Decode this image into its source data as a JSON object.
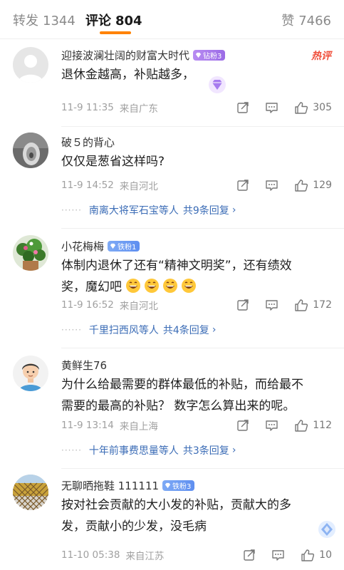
{
  "tabs": {
    "repost_label": "转发",
    "repost_count": "1344",
    "comment_label": "评论",
    "comment_count": "804",
    "like_label": "赞",
    "like_count": "7466"
  },
  "colors": {
    "accent": "#ff8200",
    "link": "#3b6cb6",
    "hot": "#f0503c"
  },
  "comments": [
    {
      "username": "迎接波澜壮阔的财富大时代",
      "badge": "钻粉3",
      "hot_tag": "热评",
      "text": "退休金越高，补贴越多，",
      "time": "11-9 11:35",
      "location": "来自广东",
      "likes": "305"
    },
    {
      "username": "破５的背心",
      "text": "仅仅是葱省这样吗?",
      "time": "11-9 14:52",
      "location": "来自河北",
      "likes": "129",
      "reply_users": "南离大将军石宝等人",
      "reply_count": "共9条回复"
    },
    {
      "username": "小花梅梅",
      "badge": "铁粉1",
      "text_line1": "体制内退休了还有“精神文明奖”，还有绩效",
      "text_line2": "奖，魔幻吧",
      "time": "11-9 16:52",
      "location": "来自河北",
      "likes": "172",
      "reply_users": "千里扫西风等人",
      "reply_count": "共4条回复"
    },
    {
      "username": "黄鲜生76",
      "text_line1": "为什么给最需要的群体最低的补贴，而给最不",
      "text_line2": "需要的最高的补贴？ 数字怎么算出来的呢。",
      "time": "11-9 13:14",
      "location": "来自上海",
      "likes": "112",
      "reply_users": "十年前事费思量等人",
      "reply_count": "共3条回复"
    },
    {
      "username": "无聊晒拖鞋 111111",
      "badge": "铁粉3",
      "text_line1": "按对社会贡献的大小发的补贴，贡献大的多",
      "text_line2": "发，贡献小的少发，没毛病",
      "time": "11-10 05:38",
      "location": "来自江苏",
      "likes": "10"
    }
  ],
  "icons": {
    "share": "share-icon",
    "reply": "comment-icon",
    "like": "thumb-up-icon",
    "emoji": "grinning-face-emoji"
  }
}
